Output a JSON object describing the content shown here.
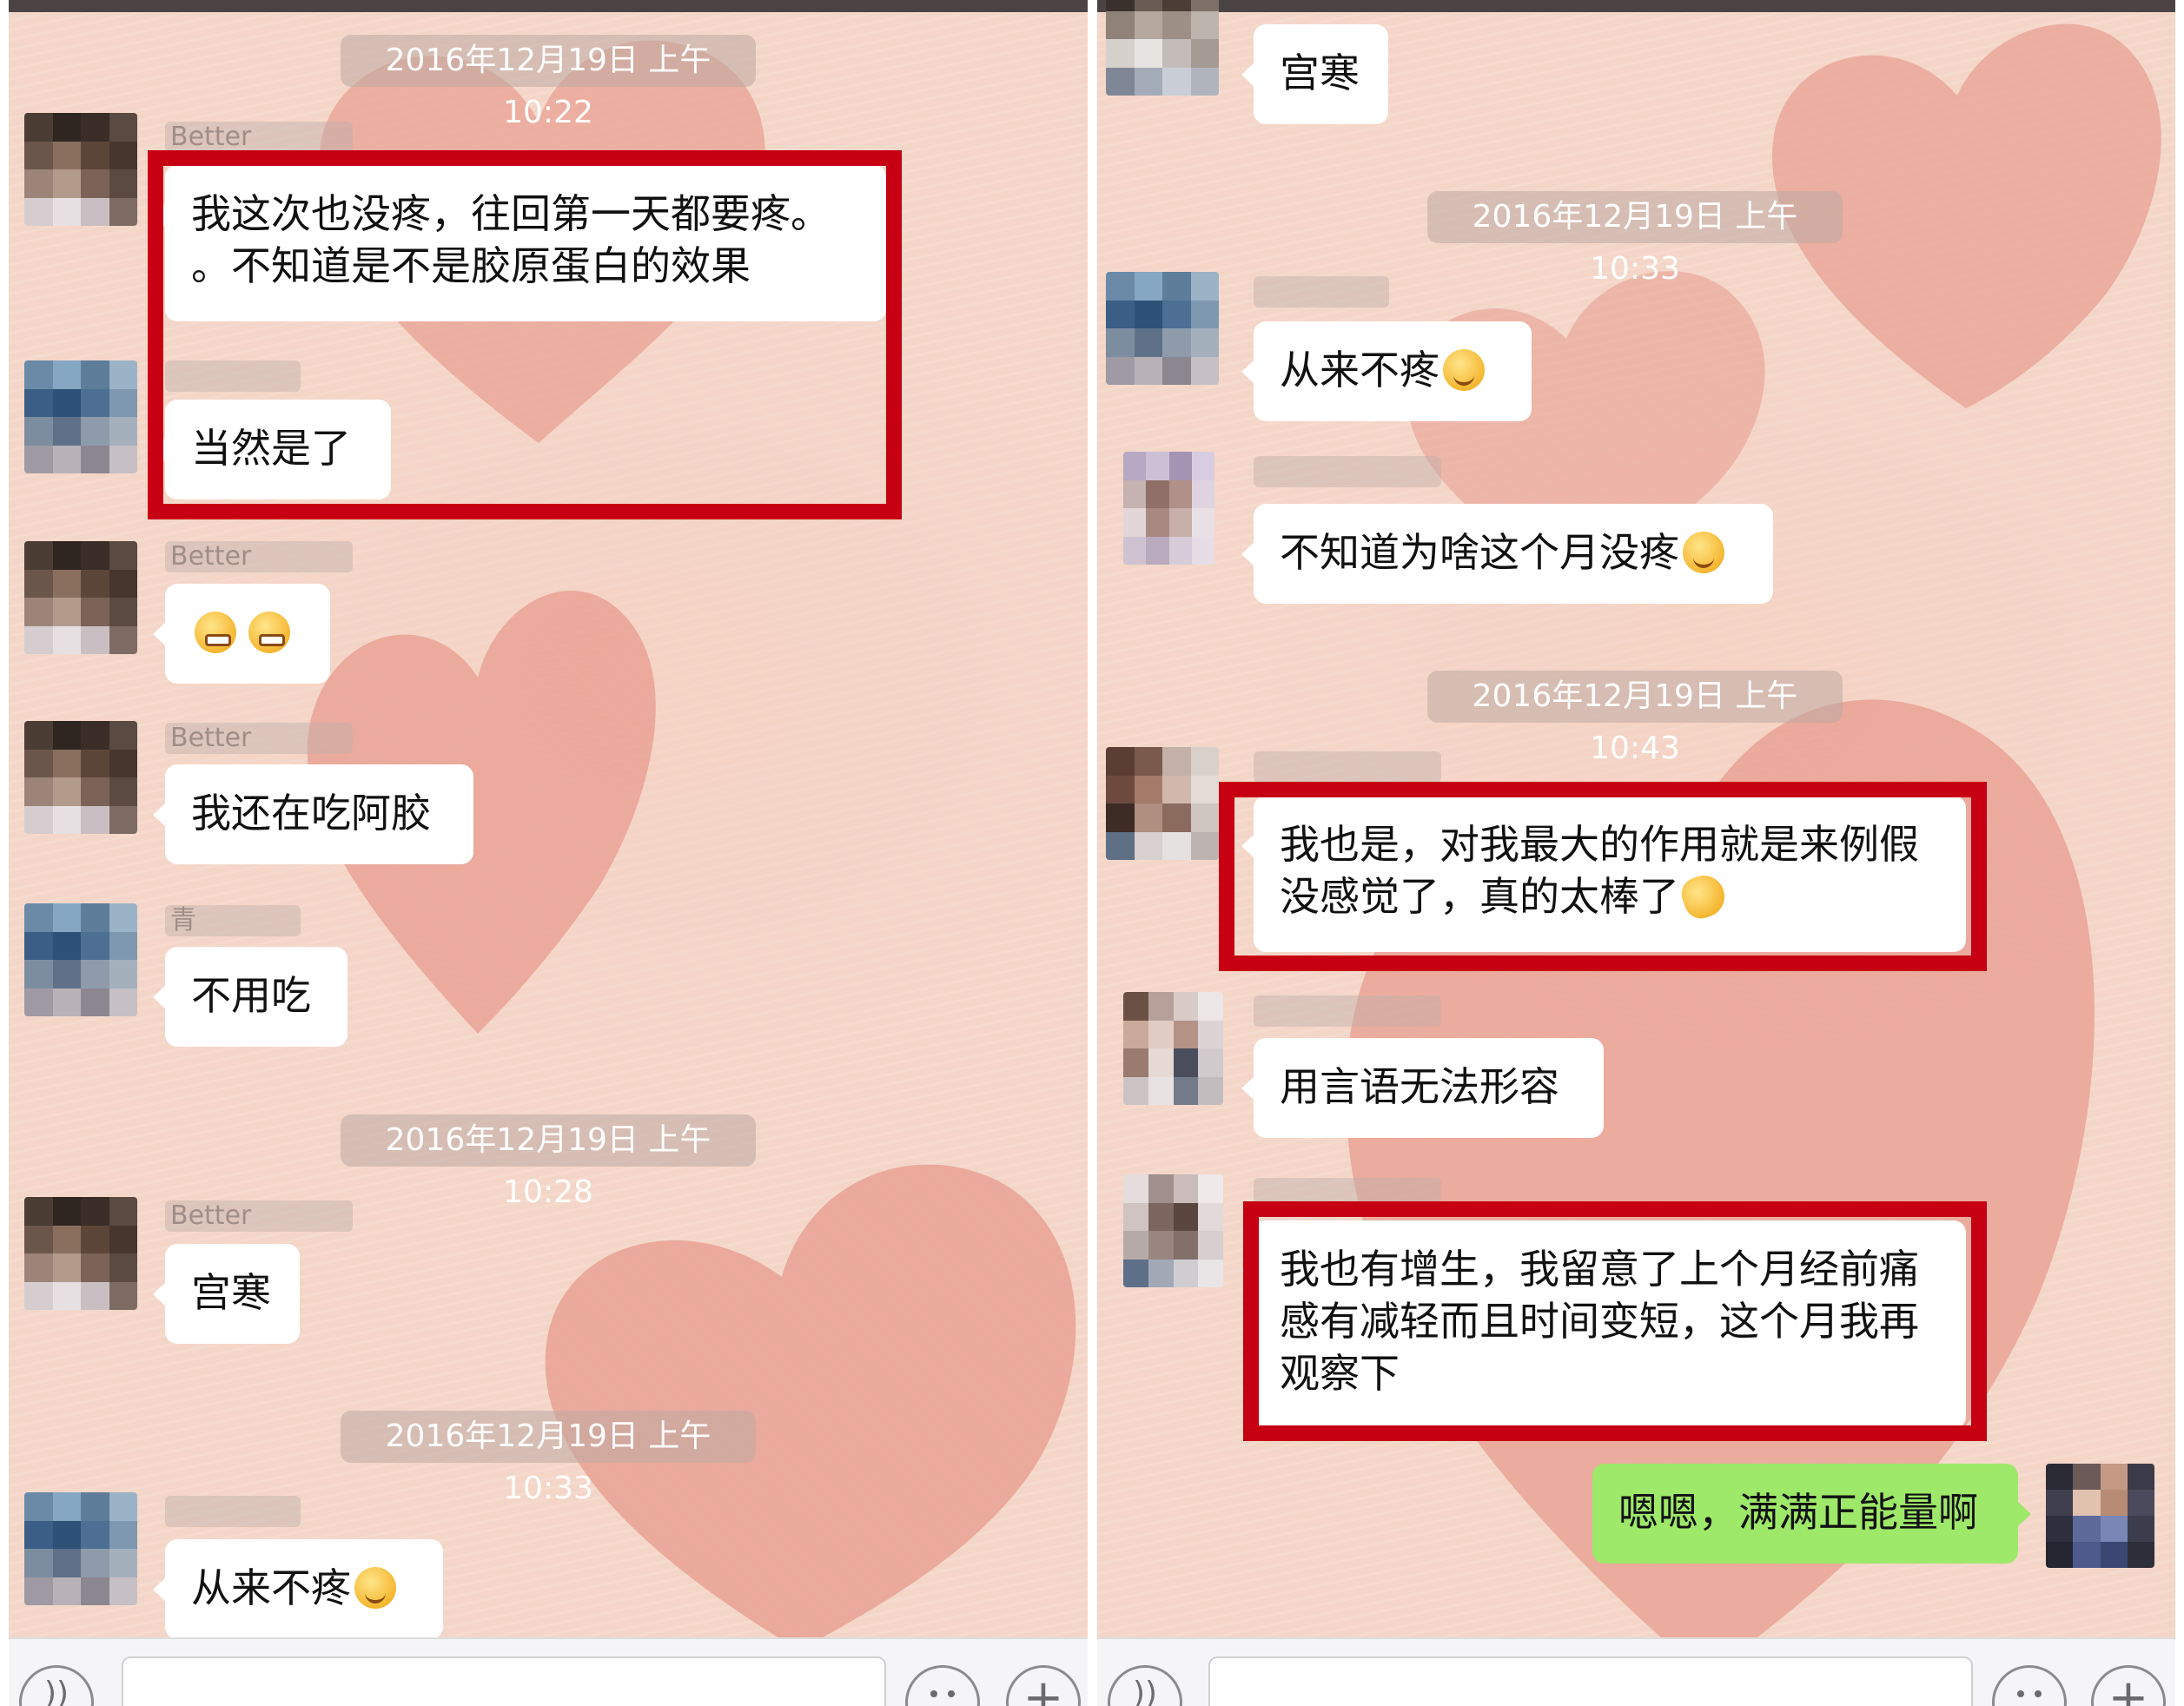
{
  "colors": {
    "chat_background": "#f4d6c8",
    "heart": "#e48e80",
    "bubble_white": "#ffffff",
    "bubble_green": "#9ee86a",
    "highlight_red": "#c60012",
    "timestamp_chip": "#bea9a2"
  },
  "left_panel": {
    "timestamps": [
      "2016年12月19日 上午10:22",
      "2016年12月19日 上午10:28",
      "2016年12月19日 上午10:33"
    ],
    "messages": [
      {
        "sender": "Better",
        "text": "我这次也没疼，往回第一天都要疼。\n。不知道是不是胶原蛋白的效果",
        "emoji": ""
      },
      {
        "sender": "",
        "text": "当然是了",
        "emoji": ""
      },
      {
        "sender": "Better",
        "text": "",
        "emoji": "grinning-emoji"
      },
      {
        "sender": "Better",
        "text": "我还在吃阿胶",
        "emoji": ""
      },
      {
        "sender": "青",
        "text": "不用吃",
        "emoji": ""
      },
      {
        "sender": "Better",
        "text": "宫寒",
        "emoji": ""
      },
      {
        "sender": "",
        "text": "从来不疼",
        "emoji": "flushed-emoji"
      }
    ]
  },
  "right_panel": {
    "timestamps": [
      "2016年12月19日 上午10:33",
      "2016年12月19日 上午10:43"
    ],
    "messages": [
      {
        "sender": "",
        "text": "宫寒",
        "emoji": ""
      },
      {
        "sender": "",
        "text": "从来不疼",
        "emoji": "flushed-emoji"
      },
      {
        "sender": "",
        "text": "不知道为啥这个月没疼",
        "emoji": "thinking-emoji"
      },
      {
        "sender": "",
        "text": "我也是，对我最大的作用就是来例假\n没感觉了，真的太棒了",
        "emoji": "clapping-emoji"
      },
      {
        "sender": "",
        "text": "用言语无法形容",
        "emoji": ""
      },
      {
        "sender": "",
        "text": "我也有增生，我留意了上个月经前痛\n感有减轻而且时间变短，这个月我再\n观察下",
        "emoji": ""
      },
      {
        "sender": "me",
        "text": "嗯嗯，满满正能量啊",
        "emoji": ""
      }
    ]
  },
  "input_bar": {
    "voice_icon": "voice-icon",
    "emoji_icon": "smiley-icon",
    "plus_icon": "plus-icon"
  }
}
